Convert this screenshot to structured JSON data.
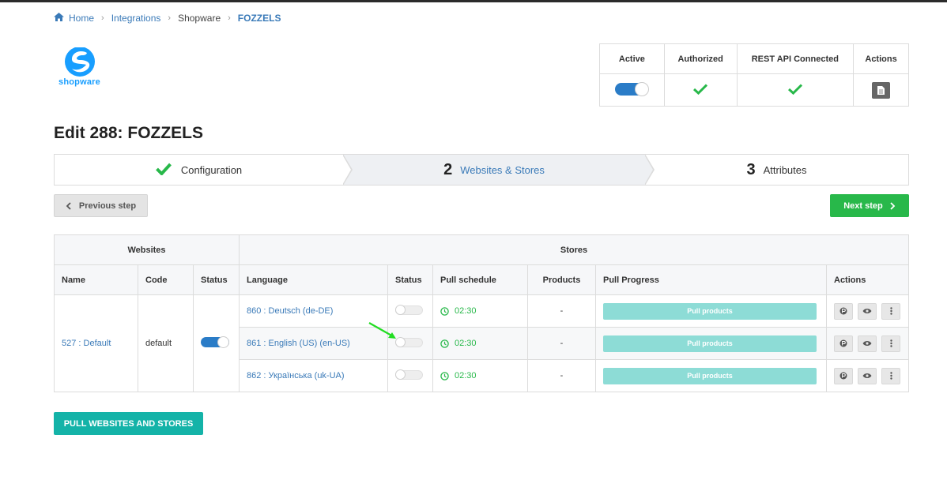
{
  "breadcrumb": {
    "home": "Home",
    "integrations": "Integrations",
    "shopware": "Shopware",
    "current": "FOZZELS"
  },
  "logo": {
    "text": "shopware"
  },
  "status": {
    "headers": [
      "Active",
      "Authorized",
      "REST API Connected",
      "Actions"
    ],
    "active": true,
    "authorized": true,
    "rest_api_connected": true
  },
  "page": {
    "title": "Edit 288: FOZZELS"
  },
  "steps": [
    {
      "num": "",
      "label": "Configuration",
      "state": "done"
    },
    {
      "num": "2",
      "label": "Websites & Stores",
      "state": "current"
    },
    {
      "num": "3",
      "label": "Attributes",
      "state": "todo"
    }
  ],
  "nav": {
    "prev": "Previous step",
    "next": "Next step"
  },
  "table": {
    "groups": {
      "websites": "Websites",
      "stores": "Stores"
    },
    "columns": [
      "Name",
      "Code",
      "Status",
      "Language",
      "Status",
      "Pull schedule",
      "Products",
      "Pull Progress",
      "Actions"
    ],
    "website": {
      "name": "527 : Default",
      "code": "default",
      "status": true
    },
    "stores": [
      {
        "language": "860 : Deutsch (de-DE)",
        "status": false,
        "schedule": "02:30",
        "products": "-",
        "progress": "Pull products"
      },
      {
        "language": "861 : English (US) (en-US)",
        "status": false,
        "schedule": "02:30",
        "products": "-",
        "progress": "Pull products"
      },
      {
        "language": "862 : Українська (uk-UA)",
        "status": false,
        "schedule": "02:30",
        "products": "-",
        "progress": "Pull products"
      }
    ]
  },
  "pull_button": "PULL WEBSITES AND STORES",
  "colors": {
    "accent": "#3a7ab8",
    "success": "#28b84a",
    "teal": "#14b3a8",
    "progress": "#8ddcd6",
    "toggle": "#2a7cc7"
  }
}
